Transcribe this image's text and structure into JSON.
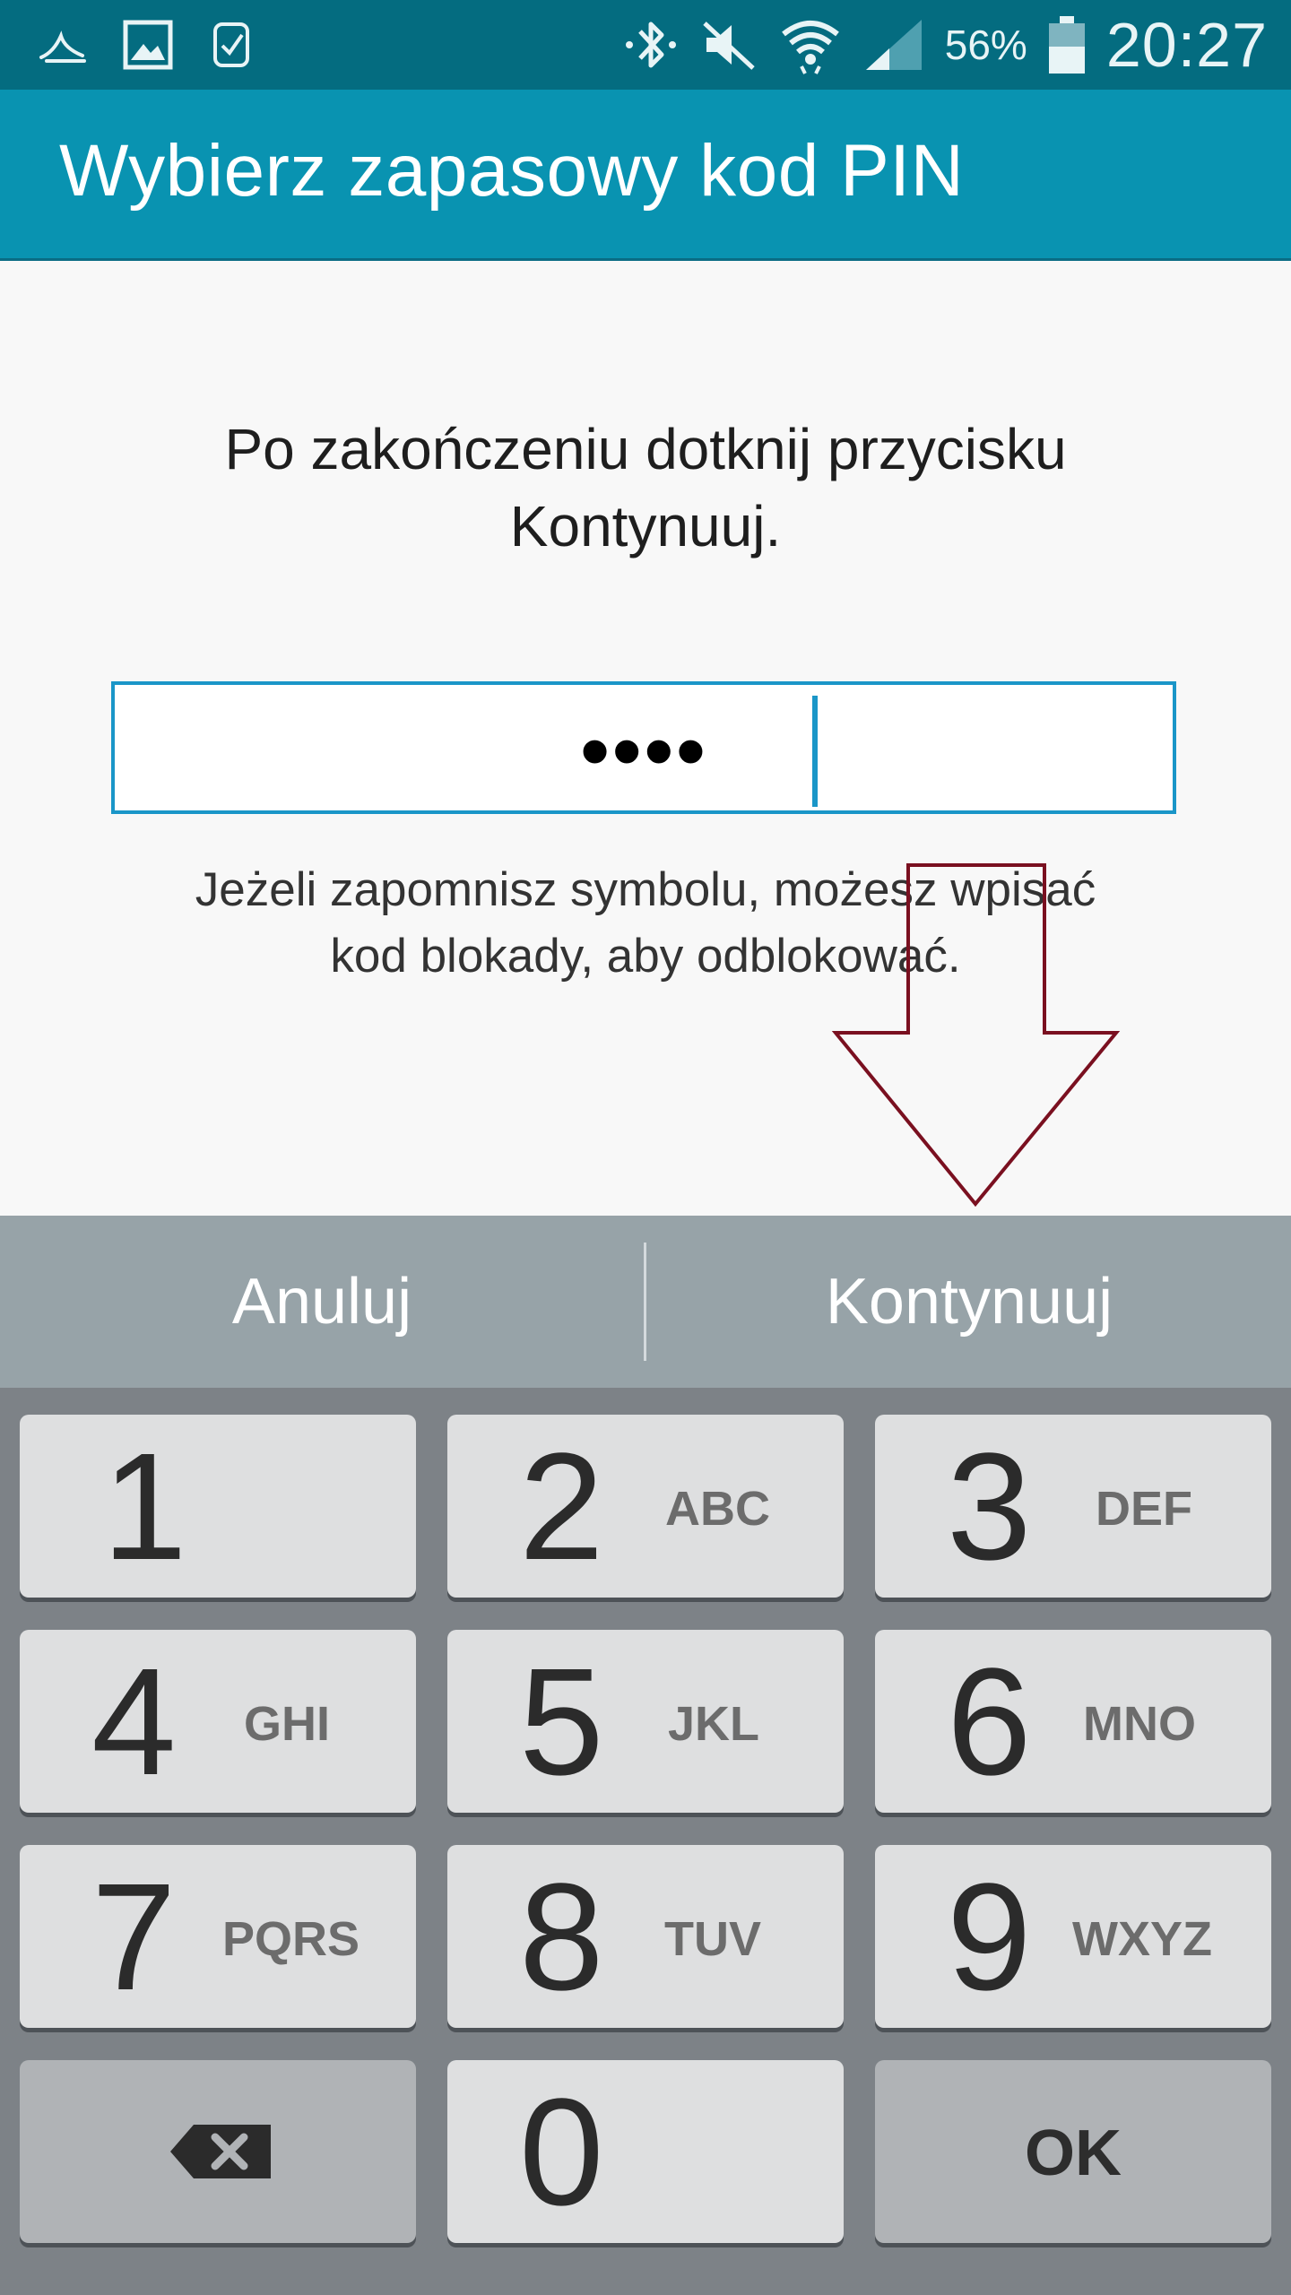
{
  "status_bar": {
    "left_icons": [
      "swiftkey-icon",
      "gallery-icon",
      "watch-icon"
    ],
    "right_icons": [
      "bluetooth-icon",
      "mute-icon",
      "wifi-icon",
      "signal-icon"
    ],
    "battery_percent": "56%",
    "time": "20:27"
  },
  "app_bar": {
    "title": "Wybierz zapasowy kod PIN"
  },
  "content": {
    "instruction_line1": "Po zakończeniu dotknij przycisku",
    "instruction_line2": "Kontynuuj.",
    "pin_mask": "••••",
    "hint_line1": "Jeżeli zapomnisz symbolu, możesz wpisać",
    "hint_line2": "kod blokady, aby odblokować."
  },
  "actions": {
    "cancel": "Anuluj",
    "continue": "Kontynuuj"
  },
  "keypad": {
    "keys": [
      {
        "digit": "1",
        "letters": ""
      },
      {
        "digit": "2",
        "letters": "ABC"
      },
      {
        "digit": "3",
        "letters": "DEF"
      },
      {
        "digit": "4",
        "letters": "GHI"
      },
      {
        "digit": "5",
        "letters": "JKL"
      },
      {
        "digit": "6",
        "letters": "MNO"
      },
      {
        "digit": "7",
        "letters": "PQRS"
      },
      {
        "digit": "8",
        "letters": "TUV"
      },
      {
        "digit": "9",
        "letters": "WXYZ"
      },
      {
        "digit": "0",
        "letters": ""
      }
    ],
    "ok_label": "OK",
    "backspace_icon": "backspace-icon"
  },
  "colors": {
    "status_bar": "#046c80",
    "app_bar": "#0993b1",
    "accent": "#1a96c8",
    "arrow_annotation": "#7a1020",
    "action_bar": "#97a3a8",
    "keypad_bg": "#7d8287"
  }
}
